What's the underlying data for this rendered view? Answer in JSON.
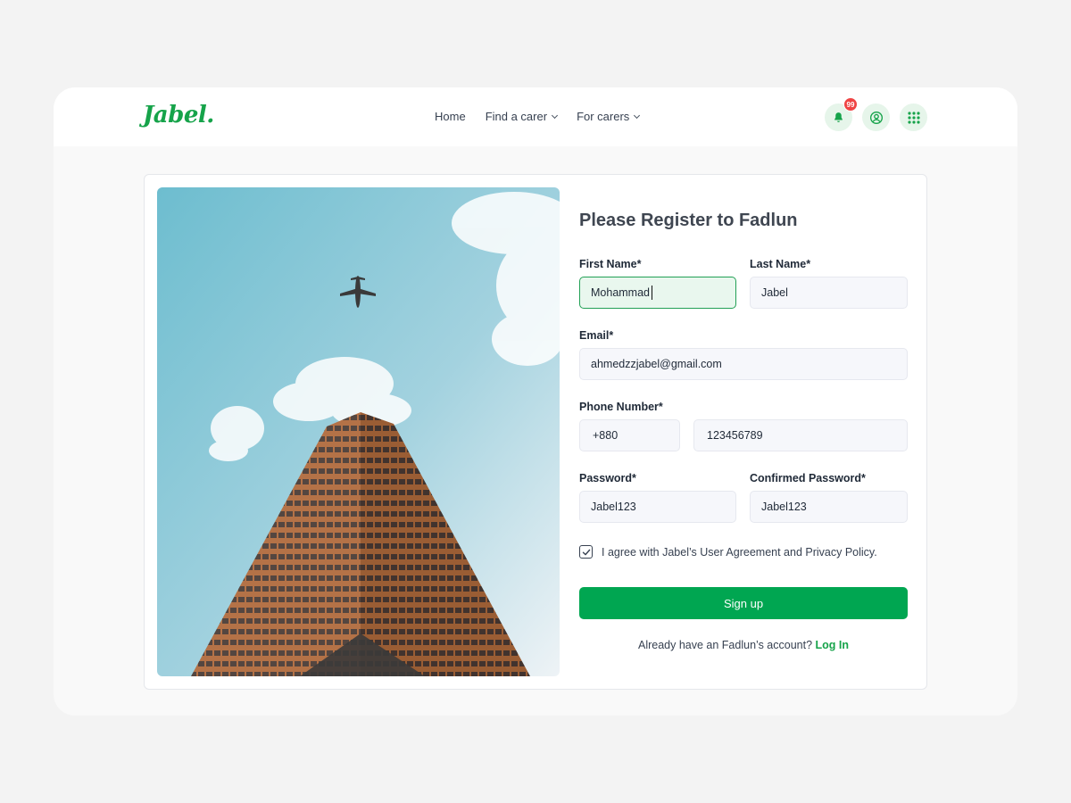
{
  "brand": {
    "logo": "Jabel."
  },
  "nav": {
    "home": "Home",
    "find_carer": "Find a carer",
    "for_carers": "For carers"
  },
  "header": {
    "notification_count": "99"
  },
  "form": {
    "title": "Please Register to Fadlun",
    "first_name_label": "First Name*",
    "first_name_value": "Mohammad",
    "last_name_label": "Last Name*",
    "last_name_value": "Jabel",
    "email_label": "Email*",
    "email_value": "ahmedzzjabel@gmail.com",
    "phone_label": "Phone Number*",
    "phone_code": "+880",
    "phone_value": "123456789",
    "password_label": "Password*",
    "password_value": "Jabel123",
    "confirm_label": "Confirmed Password*",
    "confirm_value": "Jabel123",
    "agreement": "I agree with Jabel’s User Agreement and Privacy Policy.",
    "agreement_checked": true,
    "signup_label": "Sign up",
    "already_text": "Already have an Fadlun’s account?",
    "login_label": "Log In"
  },
  "colors": {
    "brand_green": "#00a651",
    "badge_red": "#ef4444"
  },
  "icons": [
    "bell-icon",
    "user-circle-icon",
    "grid-icon",
    "check-icon",
    "chevron-down-icon"
  ]
}
